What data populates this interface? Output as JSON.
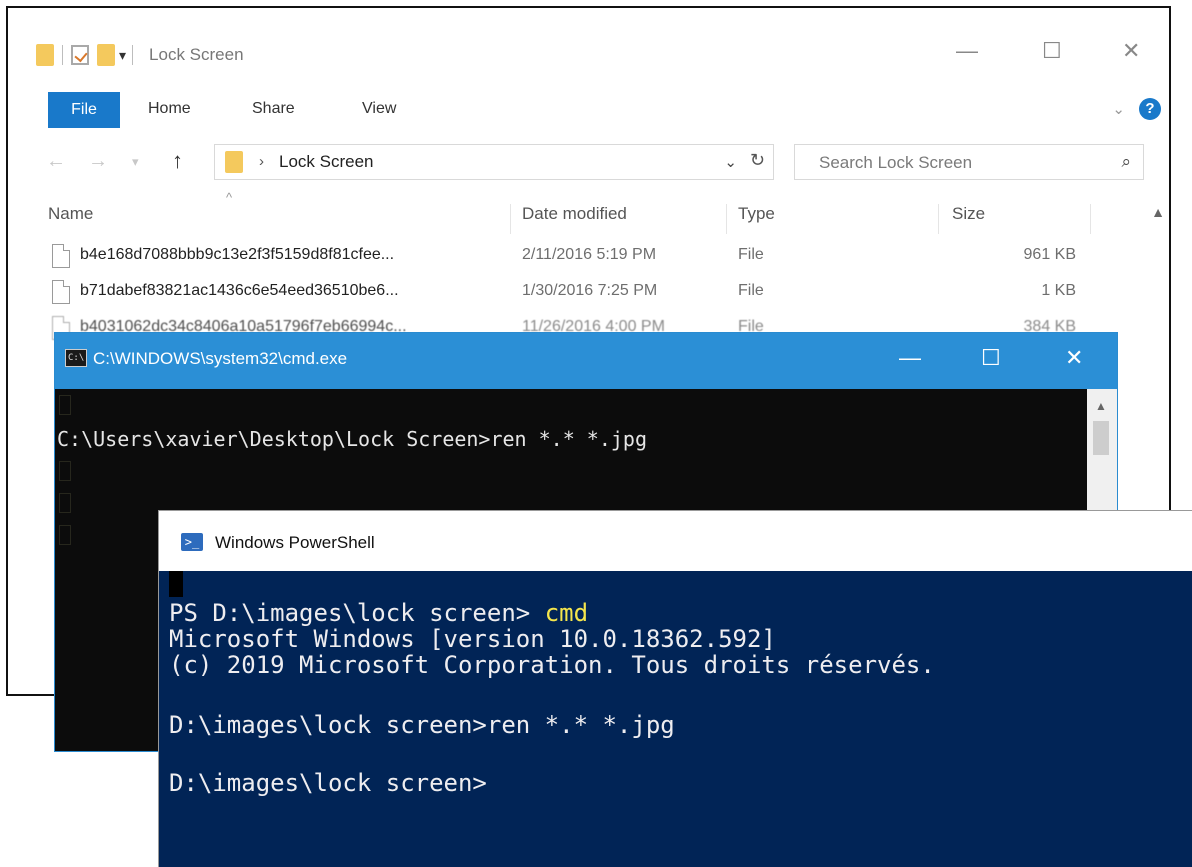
{
  "explorer": {
    "title": "Lock Screen",
    "ribbon": {
      "file": "File",
      "home": "Home",
      "share": "Share",
      "view": "View"
    },
    "window_controls": {
      "minimize": "—",
      "maximize": "☐",
      "close": "✕"
    },
    "address": {
      "separator": "›",
      "crumb": "Lock Screen"
    },
    "search": {
      "placeholder": "Search Lock Screen"
    },
    "columns": {
      "name": "Name",
      "date": "Date modified",
      "type": "Type",
      "size": "Size"
    },
    "rows": [
      {
        "name": "b4e168d7088bbb9c13e2f3f5159d8f81cfee...",
        "date": "2/11/2016 5:19 PM",
        "type": "File",
        "size": "961 KB"
      },
      {
        "name": "b71dabef83821ac1436c6e54eed36510be6...",
        "date": "1/30/2016 7:25 PM",
        "type": "File",
        "size": "1 KB"
      },
      {
        "name": "b4031062dc34c8406a10a51796f7eb66994c...",
        "date": "11/26/2016 4:00 PM",
        "type": "File",
        "size": "384 KB"
      }
    ],
    "icons": [
      "folder-icon",
      "checkmark-icon",
      "dropdown-icon",
      "up-arrow-icon",
      "refresh-icon",
      "search-icon",
      "help-icon",
      "file-icon"
    ]
  },
  "cmd": {
    "title": "C:\\WINDOWS\\system32\\cmd.exe",
    "icon_text": "C:\\",
    "window_controls": {
      "minimize": "—",
      "maximize": "☐",
      "close": "✕"
    },
    "line": "C:\\Users\\xavier\\Desktop\\Lock Screen>ren *.* *.jpg"
  },
  "powershell": {
    "title": "Windows PowerShell",
    "icon_text": ">_",
    "lines": {
      "prompt1": "PS D:\\images\\lock screen> ",
      "prompt1_cmd": "cmd",
      "line2": "Microsoft Windows [version 10.0.18362.592]",
      "line3": "(c) 2019 Microsoft Corporation. Tous droits réservés.",
      "line4": "D:\\images\\lock screen>ren *.* *.jpg",
      "line5": "D:\\images\\lock screen>"
    }
  }
}
